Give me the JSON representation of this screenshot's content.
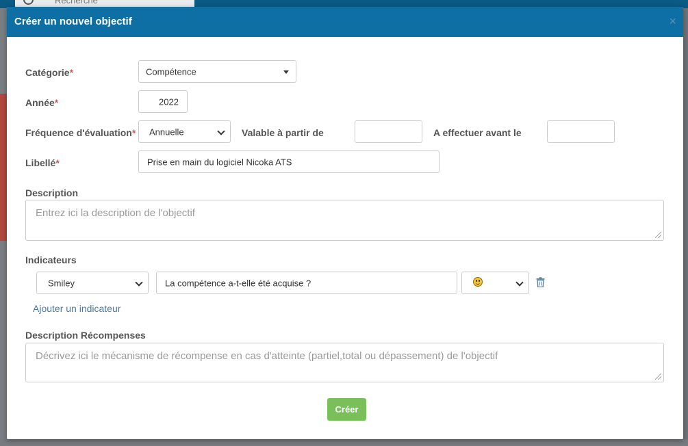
{
  "background": {
    "search_placeholder": "Recherche"
  },
  "modal": {
    "title": "Créer un nouvel objectif",
    "close_symbol": "×"
  },
  "form": {
    "categorie": {
      "label": "Catégorie",
      "value": "Compétence"
    },
    "annee": {
      "label": "Année",
      "value": "2022"
    },
    "frequence": {
      "label": "Fréquence d'évaluation",
      "value": "Annuelle"
    },
    "valable": {
      "label": "Valable à partir de",
      "value": ""
    },
    "effectuer": {
      "label": "A effectuer avant le",
      "value": ""
    },
    "libelle": {
      "label": "Libellé",
      "value": "Prise en main du logiciel Nicoka ATS"
    },
    "required_mark": "*",
    "description": {
      "label": "Description",
      "placeholder": "Entrez ici la description de l'objectif"
    },
    "indicateurs": {
      "label": "Indicateurs",
      "type_value": "Smiley",
      "question_value": "La compétence a-t-elle été acquise ?",
      "smiley_icon": "smiley-face-icon",
      "delete_icon": "trash-icon",
      "add_link": "Ajouter un indicateur"
    },
    "recompenses": {
      "label": "Description Récompenses",
      "placeholder": "Décrivez ici le mécanisme de récompense en cas d'atteinte (partiel,total ou dépassement) de l'objectif"
    },
    "submit_label": "Créer"
  },
  "colors": {
    "header": "#0e6fa4",
    "submit": "#79c05a",
    "required": "#d9534f",
    "link": "#4a7a9e"
  }
}
